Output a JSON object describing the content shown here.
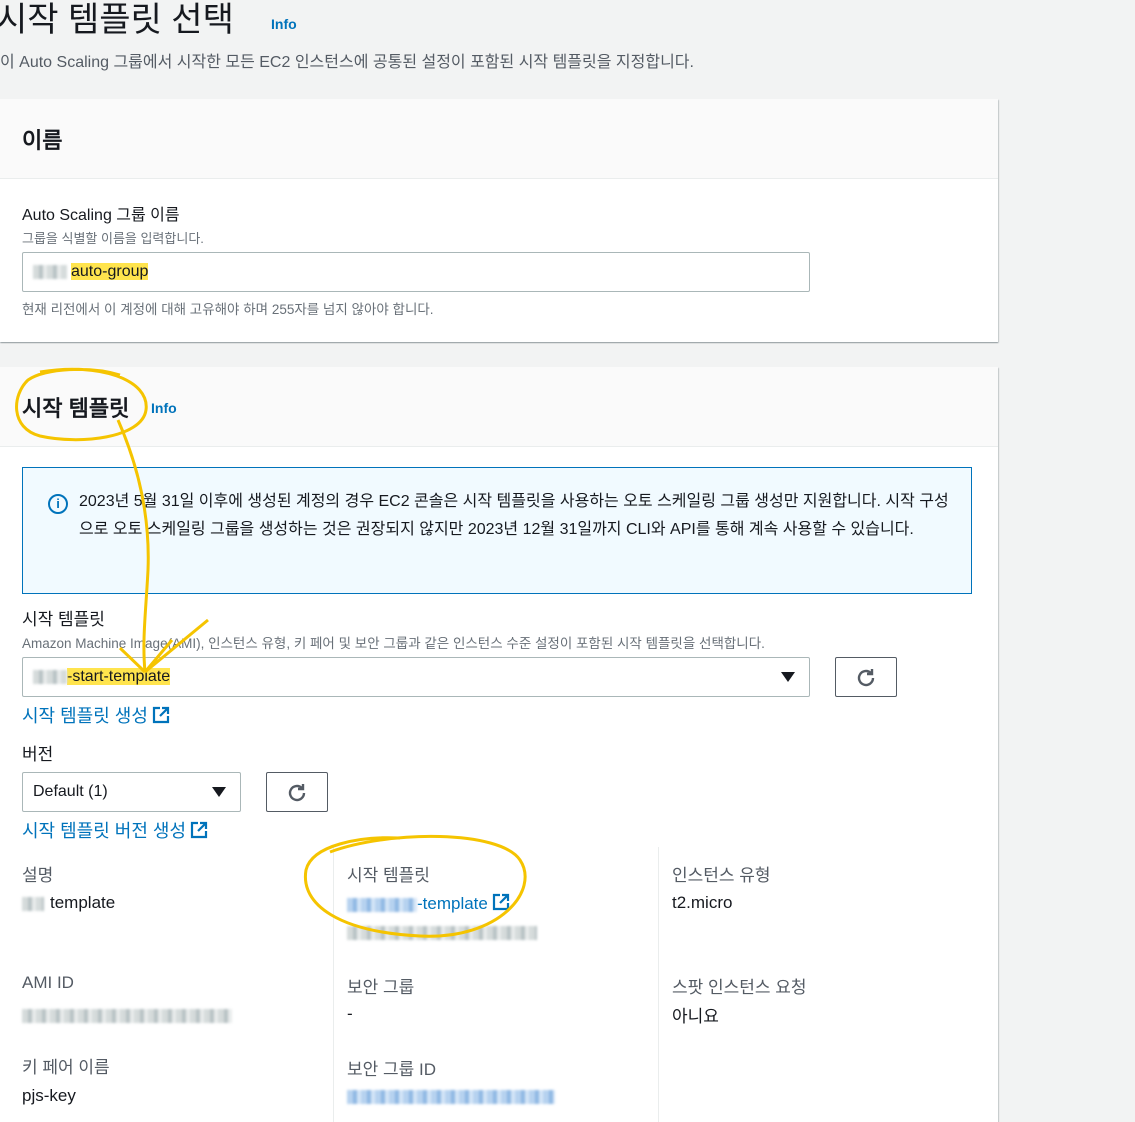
{
  "page": {
    "title": "시작 템플릿 선택",
    "info": "Info",
    "description": "이 Auto Scaling 그룹에서 시작한 모든 EC2 인스턴스에 공통된 설정이 포함된 시작 템플릿을 지정합니다."
  },
  "name_panel": {
    "title": "이름",
    "field_label": "Auto Scaling 그룹 이름",
    "field_desc": "그룹을 식별할 이름을 입력합니다.",
    "field_value": "auto-group",
    "constraint": "현재 리전에서 이 계정에 대해 고유해야 하며 255자를 넘지 않아야 합니다."
  },
  "template_panel": {
    "title": "시작 템플릿",
    "info": "Info",
    "alert": "2023년 5월 31일 이후에 생성된 계정의 경우 EC2 콘솔은 시작 템플릿을 사용하는 오토 스케일링 그룹 생성만 지원합니다. 시작 구성으로 오토 스케일링 그룹을 생성하는 것은 권장되지 않지만 2023년 12월 31일까지 CLI와 API를 통해 계속 사용할 수 있습니다.",
    "template_label": "시작 템플릿",
    "template_desc": "Amazon Machine Image(AMI), 인스턴스 유형, 키 페어 및 보안 그룹과 같은 인스턴스 수준 설정이 포함된 시작 템플릿을 선택합니다.",
    "template_value": "-start-template",
    "create_template_link": "시작 템플릿 생성",
    "version_label": "버전",
    "version_value": "Default (1)",
    "create_version_link": "시작 템플릿 버전 생성",
    "details": {
      "description_label": "설명",
      "description_value": "template",
      "launch_template_label": "시작 템플릿",
      "launch_template_value": "-template",
      "instance_type_label": "인스턴스 유형",
      "instance_type_value": "t2.micro",
      "ami_label": "AMI ID",
      "security_group_label": "보안 그룹",
      "security_group_value": "-",
      "spot_label": "스팟 인스턴스 요청",
      "spot_value": "아니요",
      "key_pair_label": "키 페어 이름",
      "key_pair_value": "pjs-key",
      "security_group_id_label": "보안 그룹 ID"
    }
  },
  "colors": {
    "link": "#0073bb",
    "highlight": "#ffe44d",
    "annotation": "#f5c400"
  },
  "icons": [
    "info-circle-icon",
    "caret-down-icon",
    "refresh-icon",
    "external-link-icon"
  ]
}
